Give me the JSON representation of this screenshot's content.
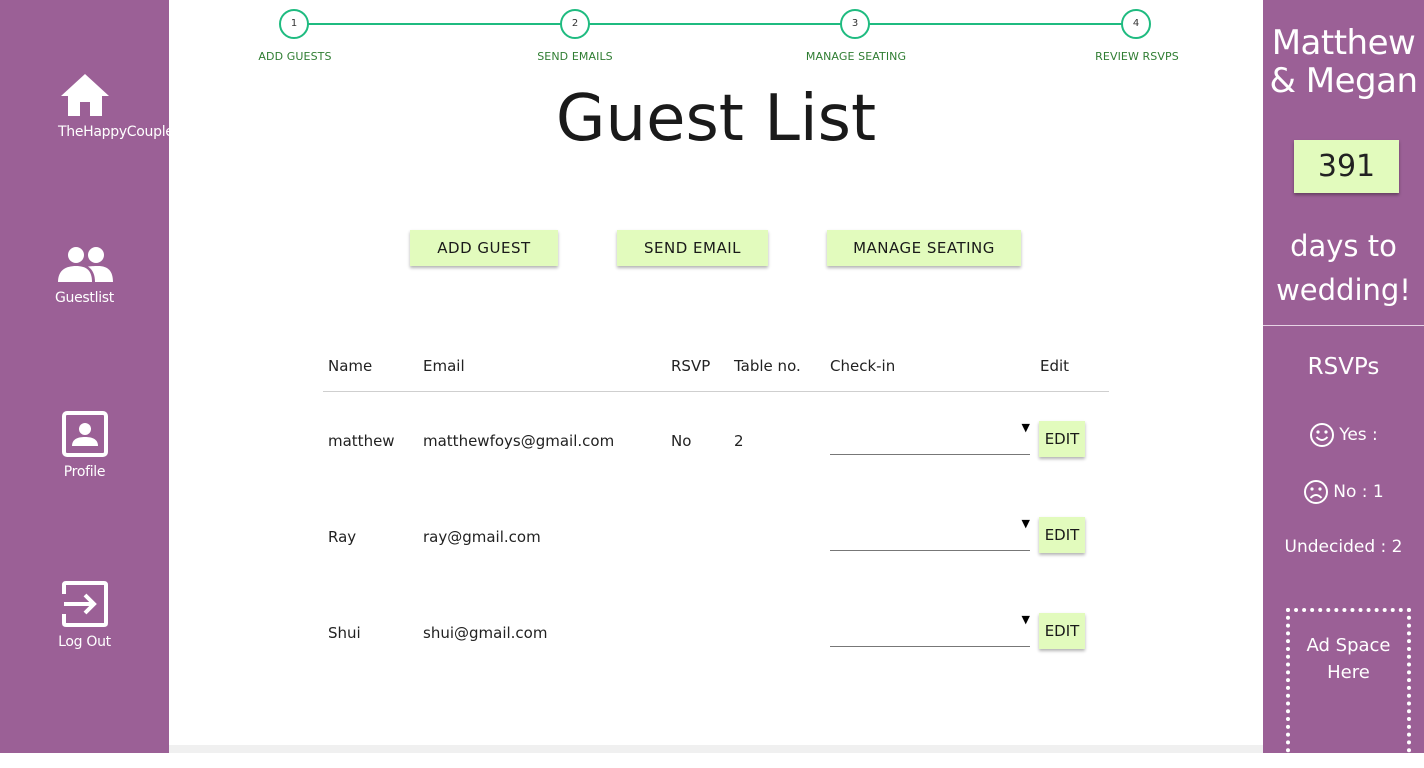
{
  "sidebar": {
    "items": [
      {
        "label": "TheHappyCouple",
        "icon": "home-icon"
      },
      {
        "label": "Guestlist",
        "icon": "people-icon"
      },
      {
        "label": "Profile",
        "icon": "profile-icon"
      },
      {
        "label": "Log Out",
        "icon": "logout-icon"
      }
    ]
  },
  "stepper": {
    "steps": [
      {
        "number": "1",
        "label": "ADD GUESTS"
      },
      {
        "number": "2",
        "label": "SEND EMAILS"
      },
      {
        "number": "3",
        "label": "MANAGE SEATING"
      },
      {
        "number": "4",
        "label": "REVIEW RSVPS"
      }
    ]
  },
  "main": {
    "title": "Guest List",
    "buttons": {
      "add_guest": "ADD GUEST",
      "send_email": "SEND EMAIL",
      "manage_seating": "MANAGE SEATING"
    }
  },
  "table": {
    "headers": [
      "Name",
      "Email",
      "RSVP",
      "Table no.",
      "Check-in",
      "Edit"
    ],
    "edit_label": "EDIT",
    "rows": [
      {
        "name": "matthew",
        "email": "matthewfoys@gmail.com",
        "rsvp": "No",
        "table": "2",
        "checkin": ""
      },
      {
        "name": "Ray",
        "email": "ray@gmail.com",
        "rsvp": "",
        "table": "",
        "checkin": ""
      },
      {
        "name": "Shui",
        "email": "shui@gmail.com",
        "rsvp": "",
        "table": "",
        "checkin": ""
      }
    ]
  },
  "right_panel": {
    "couple_line1": "Matthew",
    "couple_line2": "& Megan",
    "days_count": "391",
    "days_line1": "days to",
    "days_line2": "wedding!",
    "rsvp_heading": "RSVPs",
    "yes_label": "Yes :",
    "no_label": "No : 1",
    "undecided_label": "Undecided : 2",
    "ad_line1": "Ad Space",
    "ad_line2": "Here"
  },
  "colors": {
    "sidebar": "#9b6096",
    "button": "#e2fbbd",
    "stepper": "#1fbb80",
    "step_label": "#2f7d32"
  }
}
